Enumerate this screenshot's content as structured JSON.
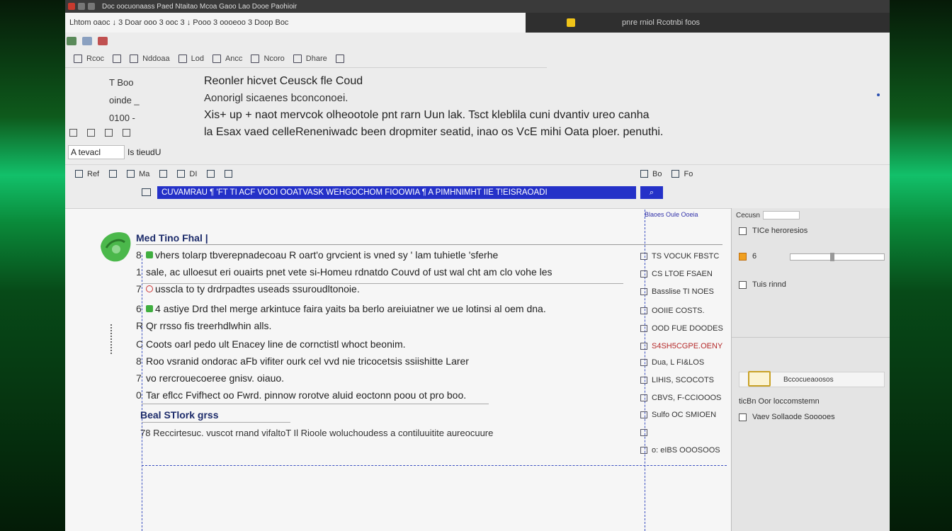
{
  "titlebar": {
    "text": "Doc  oocuonaass   Paed Ntaitao   Mcoa  Gaoo   Lao  Dooe   Paohioir"
  },
  "tab": {
    "label": "Lhtom  oaoc  ↓ 3  Doar  ooo  3  ooc  3  ↓  Pooo  3  oooeoo  3  Doop  Boc"
  },
  "tab_right": {
    "label": "pnre rniol Rcotnbi foos"
  },
  "toolbar": {
    "items": [
      "Rcoc",
      "Nddoaa",
      "Lod",
      "Ancc",
      "Ncoro",
      "Dhare"
    ]
  },
  "left_tools": [
    "T  Boo",
    "oinde _",
    "0100 -"
  ],
  "doc": {
    "title": "Reonler hicvet Ceusck fle Coud",
    "subtitle": "Aonorigl sicaenes bconconoei.",
    "line1": "Xis+ up + naot mervcok olheootole pnt rarn Uun lak. Tsct kleblila cuni dvantiv ureo canha",
    "line2": "la Esax vaed celleReneniwadc been dropmiter seatid, inao os VcE mihi Oata ploer. penuthi."
  },
  "address": {
    "value": "A tevacl",
    "label": "Is tieudU"
  },
  "ribbon2": {
    "items": [
      "Ref",
      "Ma",
      "DI"
    ],
    "right_items": [
      "Bo",
      "Fo"
    ]
  },
  "highlight_bar": {
    "text": "CUVAMRAU  ¶ 'FT  TI  ACF  VOOI  OOATVASK  WEHGOCHOM  FIOOWIA  ¶ A  PIMHNIMHT  IIE  T!EISRAOADI",
    "button": "⌕"
  },
  "section": {
    "label": "Med Tino Fhal",
    "marker": "|"
  },
  "bullets": [
    {
      "mark": "8",
      "icon": "dot",
      "text": "vhers tolarp tbverepnadecoau R oart'o grvcient is vned sy ' lam tuhietle 'sferhe"
    },
    {
      "mark": "1",
      "icon": "none",
      "text": "sale, ac ulloesut eri ouairts pnet vete si-Homeu rdnatdo Couvd of ust wal cht am clo vohe les"
    },
    {
      "mark": "7",
      "icon": "red",
      "text": "usscla to ty drdrpadtes useads ssuroudltonoie."
    },
    {
      "mark": "6",
      "icon": "green",
      "text": "4  astiye Drd thel merge arkintuce faira yaits ba berlo areiuiatner we ue lotinsi al oem dna."
    },
    {
      "mark": "R",
      "icon": "none",
      "text": "Qr rrsso fis treerhdlwhin alls."
    },
    {
      "mark": "C",
      "icon": "none",
      "text": "Coots oarl pedo ult Enacey line de cornctistl whoct beonim."
    },
    {
      "mark": "8",
      "icon": "none",
      "text": "Roo vsranid ondorac aFb vifiter ourk cel vvd nie tricocetsis ssiishitte Larer"
    },
    {
      "mark": "7",
      "icon": "none",
      "text": "vo rercrouecoeree gnisv.   oiauo."
    },
    {
      "mark": "0",
      "icon": "none",
      "text": "Tar eflcc  Fvifhect oo Fwrd. pinnow rorotve aluid eoctonn poou ot pro boo."
    }
  ],
  "subhead": "Beal STlork grss",
  "subline": "78 Reccirtesuc. vuscot rnand vifaltoT Il Rioole woluchoudess a contiluuitite aureocuure",
  "style_panel": {
    "header": "Blaoes Oule Ooeia",
    "items": [
      {
        "label": "TS VOCUK FBSTC",
        "red": false
      },
      {
        "label": "CS LTOE FSAEN",
        "red": false
      },
      {
        "label": "Basslise TI NOES",
        "red": false
      },
      {
        "label": "OOIIE COSTS.",
        "red": false
      },
      {
        "label": "OOD FUE DOODES",
        "red": true
      },
      {
        "label": "S4SH5CGPE.OENY",
        "red": true
      },
      {
        "label": "Dua, L FI&LOS",
        "red": true
      },
      {
        "label": "LIHIS, SCOCOTS",
        "red": false
      },
      {
        "label": "CBVS, F-CCIOOOS",
        "red": false
      },
      {
        "label": "Sulfo OC SMIOEN",
        "red": false
      },
      {
        "label": "",
        "red": false
      },
      {
        "label": "o: eIBS OOOSOOS",
        "red": false
      }
    ]
  },
  "right_panel": {
    "top_label": "Cecusn",
    "rows": [
      "TICe heroresios",
      "6",
      "Tuis rinnd"
    ],
    "card": "Bccocueaoosos",
    "lower_rows": [
      "ticBn Oor loccomstemn",
      "Vaev Sollaode Sooooes"
    ]
  }
}
